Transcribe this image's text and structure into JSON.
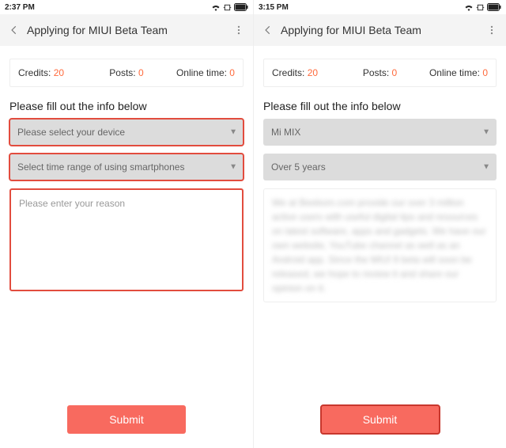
{
  "left": {
    "status": {
      "time": "2:37 PM"
    },
    "header": {
      "title": "Applying for MIUI Beta Team"
    },
    "stats": {
      "credits_label": "Credits: ",
      "credits_value": "20",
      "posts_label": "Posts: ",
      "posts_value": "0",
      "online_label": "Online time: ",
      "online_value": "0"
    },
    "prompt": "Please fill out the info below",
    "device_select": {
      "placeholder": "Please select your device"
    },
    "time_select": {
      "placeholder": "Select time range of using smartphones"
    },
    "reason": {
      "placeholder": "Please enter your reason"
    },
    "submit_label": "Submit"
  },
  "right": {
    "status": {
      "time": "3:15 PM"
    },
    "header": {
      "title": "Applying for MIUI Beta Team"
    },
    "stats": {
      "credits_label": "Credits: ",
      "credits_value": "20",
      "posts_label": "Posts: ",
      "posts_value": "0",
      "online_label": "Online time: ",
      "online_value": "0"
    },
    "prompt": "Please fill out the info below",
    "device_select": {
      "value": "Mi MIX"
    },
    "time_select": {
      "value": "Over 5 years"
    },
    "reason": {
      "value": "We at Beebom.com provide our over 3 million active users with useful digital tips and resources on latest software, apps and gadgets. We have our own website, YouTube channel as well as an Android app. Since the MIUI 9 beta will soon be released, we hope to review it and share our opinion on it."
    },
    "submit_label": "Submit"
  },
  "icons": {
    "back": "chevron-left",
    "menu": "vertical-dots",
    "wifi": "wifi",
    "rotate": "screen-rotate",
    "battery": "battery"
  }
}
